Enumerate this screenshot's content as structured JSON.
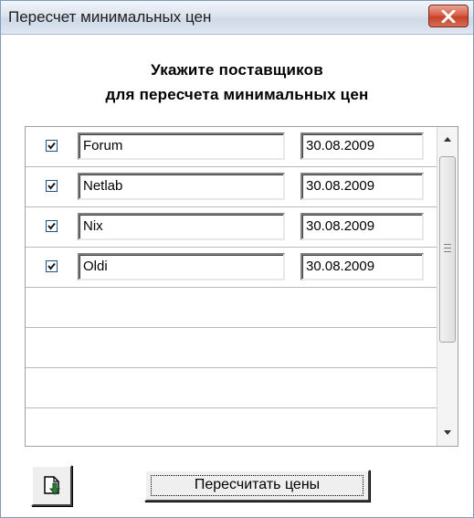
{
  "window": {
    "title": "Пересчет минимальных цен",
    "close_icon": "close-icon"
  },
  "heading": {
    "line1": "Укажите поставщиков",
    "line2": "для пересчета минимальных цен"
  },
  "suppliers": [
    {
      "checked": true,
      "name": "Forum",
      "date": "30.08.2009"
    },
    {
      "checked": true,
      "name": "Netlab",
      "date": "30.08.2009"
    },
    {
      "checked": true,
      "name": "Nix",
      "date": "30.08.2009"
    },
    {
      "checked": true,
      "name": "Oldi",
      "date": "30.08.2009"
    }
  ],
  "buttons": {
    "icon_button_icon": "import-icon",
    "recalc_label": "Пересчитать цены"
  }
}
